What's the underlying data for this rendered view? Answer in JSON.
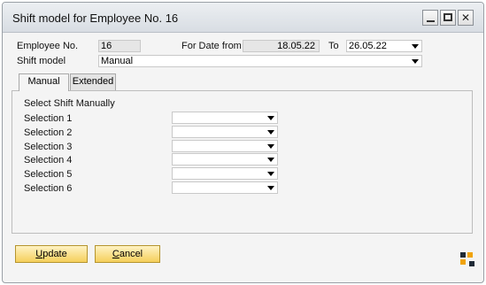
{
  "window": {
    "title": "Shift model for Employee No. 16"
  },
  "header": {
    "employee_no_label": "Employee No.",
    "employee_no_value": "16",
    "for_date_from_label": "For Date from",
    "date_from_value": "18.05.22",
    "to_label": "To",
    "date_to_value": "26.05.22",
    "shift_model_label": "Shift model",
    "shift_model_value": "Manual"
  },
  "tabs": [
    {
      "label": "Manual",
      "active": true
    },
    {
      "label": "Extended",
      "active": false
    }
  ],
  "manual": {
    "heading": "Select Shift Manually",
    "selections": [
      {
        "label": "Selection 1",
        "value": ""
      },
      {
        "label": "Selection 2",
        "value": ""
      },
      {
        "label": "Selection 3",
        "value": ""
      },
      {
        "label": "Selection 4",
        "value": ""
      },
      {
        "label": "Selection 5",
        "value": ""
      },
      {
        "label": "Selection 6",
        "value": ""
      }
    ]
  },
  "buttons": {
    "update": {
      "prefix": "",
      "underlined": "U",
      "rest": "pdate"
    },
    "cancel": {
      "prefix": "",
      "underlined": "C",
      "rest": "ancel"
    }
  },
  "colors": {
    "button_gradient_top": "#fff3c4",
    "button_gradient_bottom": "#f5cf5b",
    "brand_orange": "#f0a30a"
  }
}
